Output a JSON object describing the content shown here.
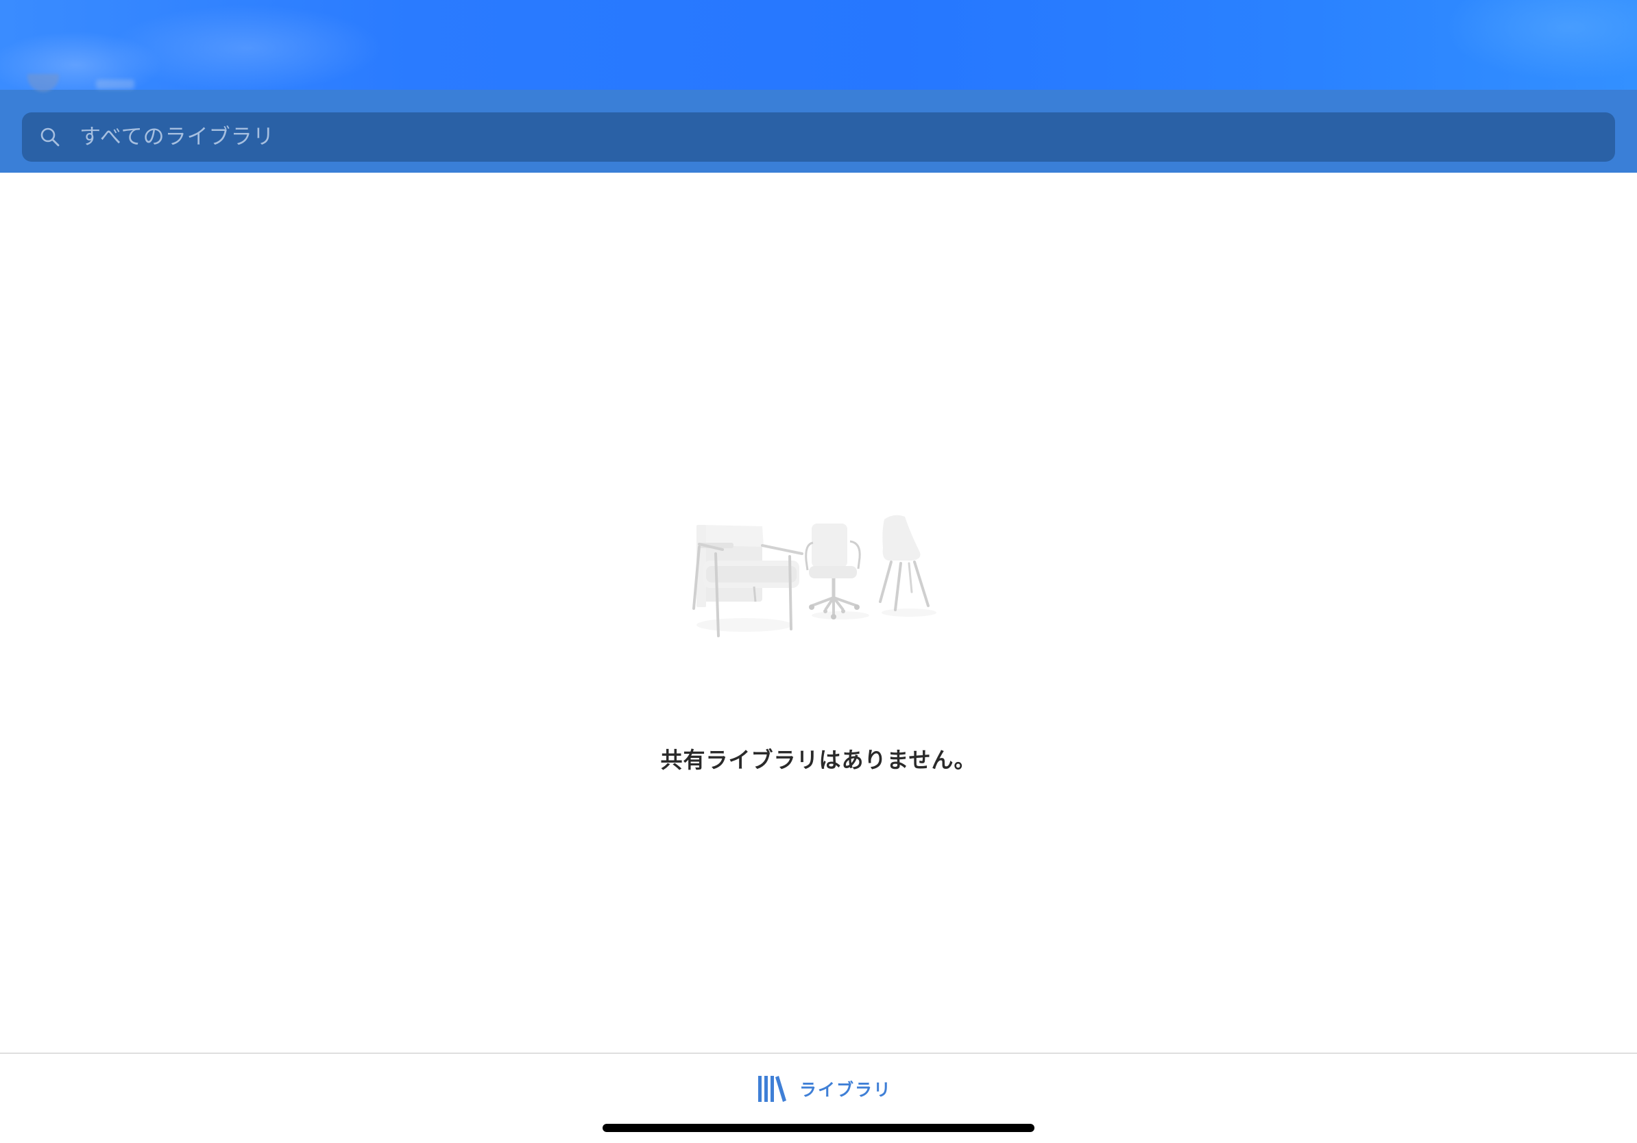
{
  "header": {
    "search": {
      "placeholder": "すべてのライブラリ",
      "value": ""
    }
  },
  "empty_state": {
    "illustration": "chairs-illustration",
    "message": "共有ライブラリはありません。"
  },
  "tab_bar": {
    "tabs": [
      {
        "label": "ライブラリ",
        "icon": "library-books-icon",
        "selected": true
      }
    ]
  },
  "colors": {
    "header_background": "#3a7fd7",
    "search_bar_background": "#2a61a6",
    "placeholder": "#a6bfe0",
    "accent": "#3f7fd6",
    "empty_text": "#2a2a2a"
  }
}
